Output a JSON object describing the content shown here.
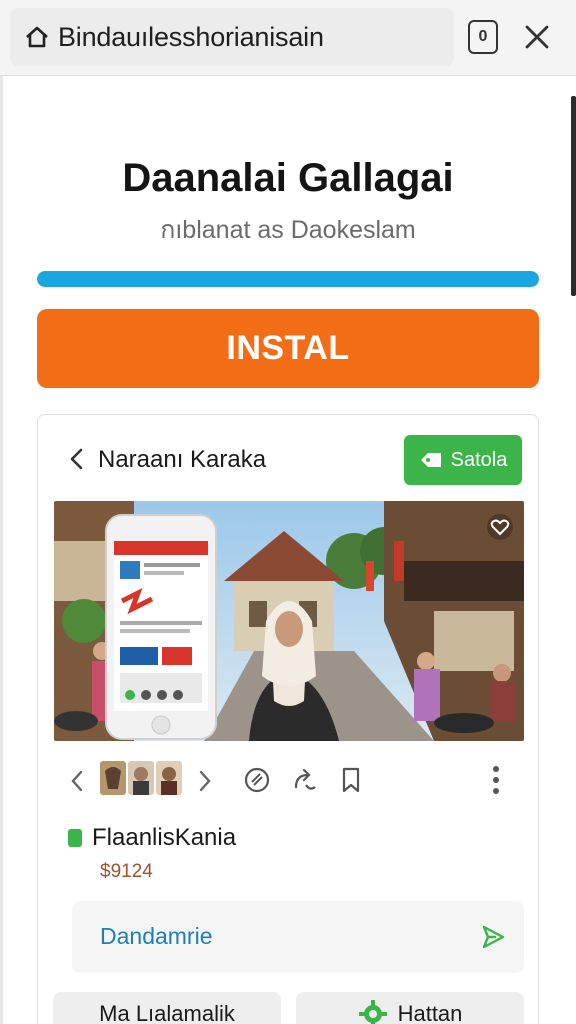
{
  "browser": {
    "url": "Bindauılesshorianisain",
    "tabs_label": "0",
    "icons": [
      "home-icon",
      "tabs-icon",
      "close-icon"
    ]
  },
  "app": {
    "title": "Daanalai Gallagai",
    "subtitle": "กıblanat as Daokeslam",
    "install_progress": 1.0,
    "install_label": "INSTAL"
  },
  "card": {
    "title": "Naraanı Karaka",
    "share_label": "Satola",
    "photo_alt": "",
    "item_name": "FlaanlisKania",
    "item_price": "$9124",
    "download_label": "Dandamrie"
  },
  "bottom": {
    "left_label": "Ma Lıalamalik",
    "right_label": "Hattan"
  },
  "colors": {
    "accent_blue": "#1aa6e0",
    "install_orange": "#f36d17",
    "share_green": "#3bb54a",
    "link_blue": "#1f7fb4",
    "price": "#a0522d"
  }
}
